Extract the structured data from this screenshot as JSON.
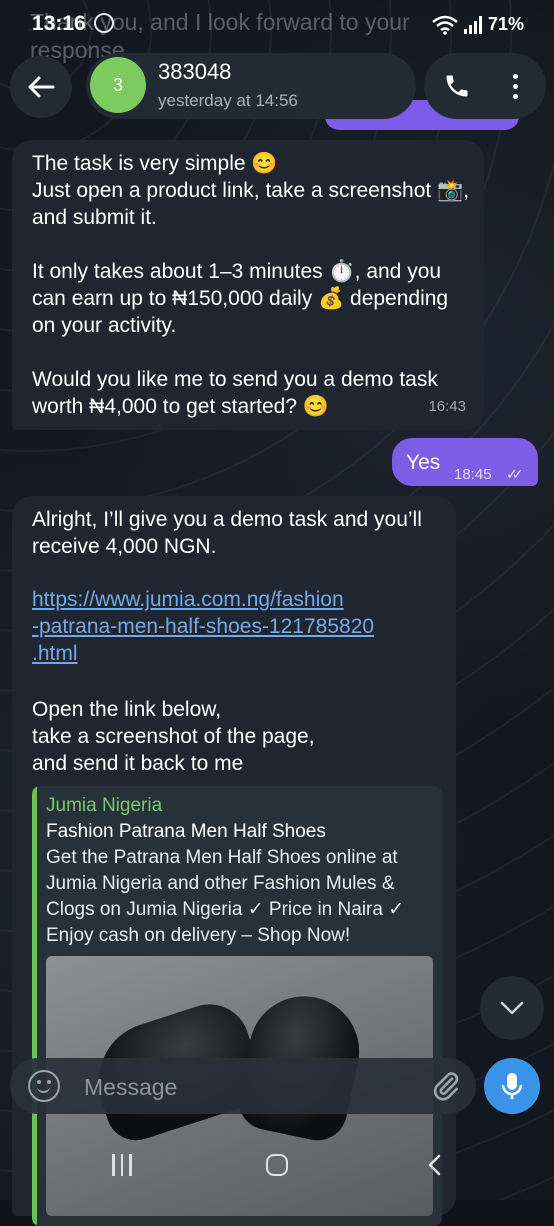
{
  "status_bar": {
    "time": "13:16",
    "bleed_text": "Thank you, and I look forward to your response",
    "battery": "71%",
    "network": "6"
  },
  "header": {
    "avatar_text": "3",
    "chat_name": "383048",
    "last_seen": "yesterday at 14:56"
  },
  "messages": [
    {
      "direction": "in",
      "text": "The task is very simple 😊\nJust open a product link, take a screenshot 📸, and submit it.\n\nIt only takes about 1–3 minutes ⏱️, and you can earn up to ₦150,000 daily 💰 depending on your activity.\n\nWould you like me to send you a demo task worth ₦4,000 to get started? 😊",
      "time": "16:43"
    },
    {
      "direction": "out",
      "text": "Yes",
      "time": "18:45",
      "status": "read"
    },
    {
      "direction": "in",
      "text": "Alright, I’ll give you a demo task and you’ll receive 4,000 NGN.",
      "link": "https://www.jumia.com.ng/fashion-patrana-men-half-shoes-121785820.html",
      "link_display": "https://www.jumia.com.ng/fashion\n-patrana-men-half-shoes-121785820\n.html",
      "text2": "Open the link below,\ntake a screenshot of the page,\nand send it back to me",
      "preview": {
        "site": "Jumia Nigeria",
        "title": "Fashion Patrana Men Half Shoes",
        "description": "Get the Patrana Men Half Shoes online at Jumia Nigeria and other Fashion Mules & Clogs on Jumia Nigeria ✓ Price in Naira ✓ Enjoy cash on delivery – Shop Now!"
      }
    }
  ],
  "composer": {
    "placeholder": "Message"
  },
  "colors": {
    "outgoing_bubble": "#7d5ce6",
    "incoming_bubble": "#1f262f",
    "link": "#73a9e8",
    "preview_accent": "#67c25a",
    "mic_button": "#3b93e8",
    "avatar": "#7ccb5e"
  },
  "icons": [
    "whatsapp-status-icon",
    "wifi-icon",
    "signal-icon",
    "back-arrow-icon",
    "phone-icon",
    "more-vert-icon",
    "chevron-down-icon",
    "emoji-icon",
    "paperclip-icon",
    "mic-icon",
    "nav-recents-icon",
    "nav-home-icon",
    "nav-back-icon",
    "double-check-icon"
  ]
}
